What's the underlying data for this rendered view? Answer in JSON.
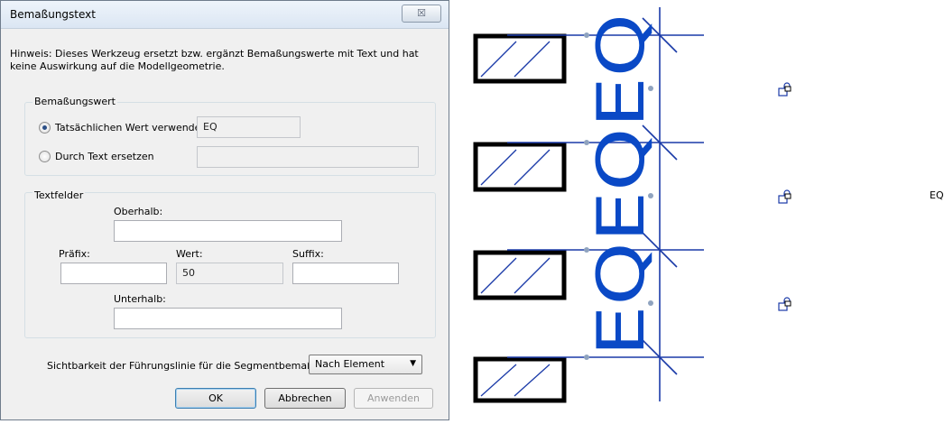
{
  "dialog": {
    "title": "Bemaßungstext",
    "close_label": "☒",
    "hint": "Hinweis: Dieses Werkzeug ersetzt bzw. ergänzt Bemaßungswerte mit Text und hat keine Auswirkung auf die Modellgeometrie.",
    "value_group": {
      "title": "Bemaßungswert",
      "use_actual_label": "Tatsächlichen Wert verwenden",
      "use_actual_value": "EQ",
      "use_actual_checked": true,
      "replace_label": "Durch Text ersetzen",
      "replace_value": ""
    },
    "text_fields": {
      "title": "Textfelder",
      "above_label": "Oberhalb:",
      "above_value": "",
      "prefix_label": "Präfix:",
      "prefix_value": "",
      "value_label": "Wert:",
      "value_value": "50",
      "suffix_label": "Suffix:",
      "suffix_value": "",
      "below_label": "Unterhalb:",
      "below_value": ""
    },
    "leader": {
      "label": "Sichtbarkeit der Führungslinie für die Segmentbemaßung:",
      "selected": "Nach Element"
    },
    "buttons": {
      "ok": "OK",
      "cancel": "Abbrechen",
      "apply": "Anwenden"
    }
  },
  "drawing": {
    "dimension_text": "EQEQEQ",
    "side_label": "EQ",
    "line_color": "#1a3aa8",
    "text_color": "#0a49c6",
    "lock_icon": "lock-icon"
  }
}
